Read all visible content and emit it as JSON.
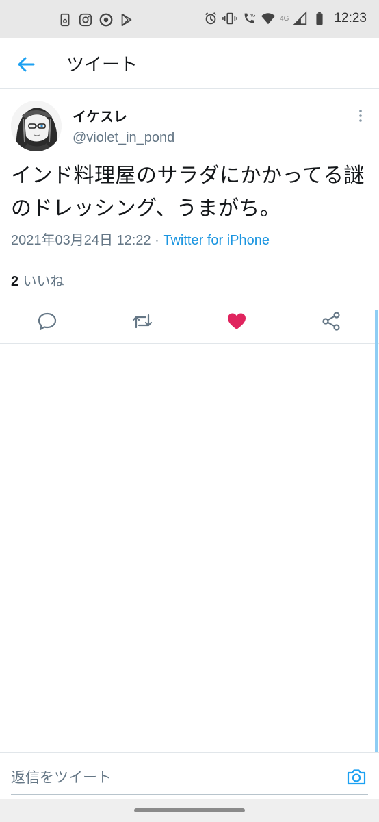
{
  "status_bar": {
    "time": "12:23",
    "network": "4G",
    "left_icons": [
      "phone-app-icon",
      "instagram-icon",
      "browser-icon",
      "play-store-icon"
    ],
    "right_icons": [
      "alarm-icon",
      "vibrate-icon",
      "volte-call-icon",
      "wifi-icon",
      "signal-icon",
      "battery-icon"
    ]
  },
  "header": {
    "title": "ツイート",
    "back_icon": "arrow-left-icon"
  },
  "tweet": {
    "display_name": "イケスレ",
    "handle": "@violet_in_pond",
    "text": "インド料理屋のサラダにかかってる謎のドレッシング、うまがち。",
    "date": "2021年03月24日 12:22",
    "separator": " · ",
    "source": "Twitter for iPhone",
    "likes_count": "2",
    "likes_label": " いいね",
    "liked": true
  },
  "actions": [
    "reply-icon",
    "retweet-icon",
    "like-icon",
    "share-icon"
  ],
  "reply": {
    "placeholder": "返信をツイート",
    "camera_icon": "camera-icon"
  },
  "colors": {
    "accent": "#1da1f2",
    "like": "#e0245e",
    "secondary_text": "#657786",
    "scrollbar": "#8ecdf4"
  }
}
